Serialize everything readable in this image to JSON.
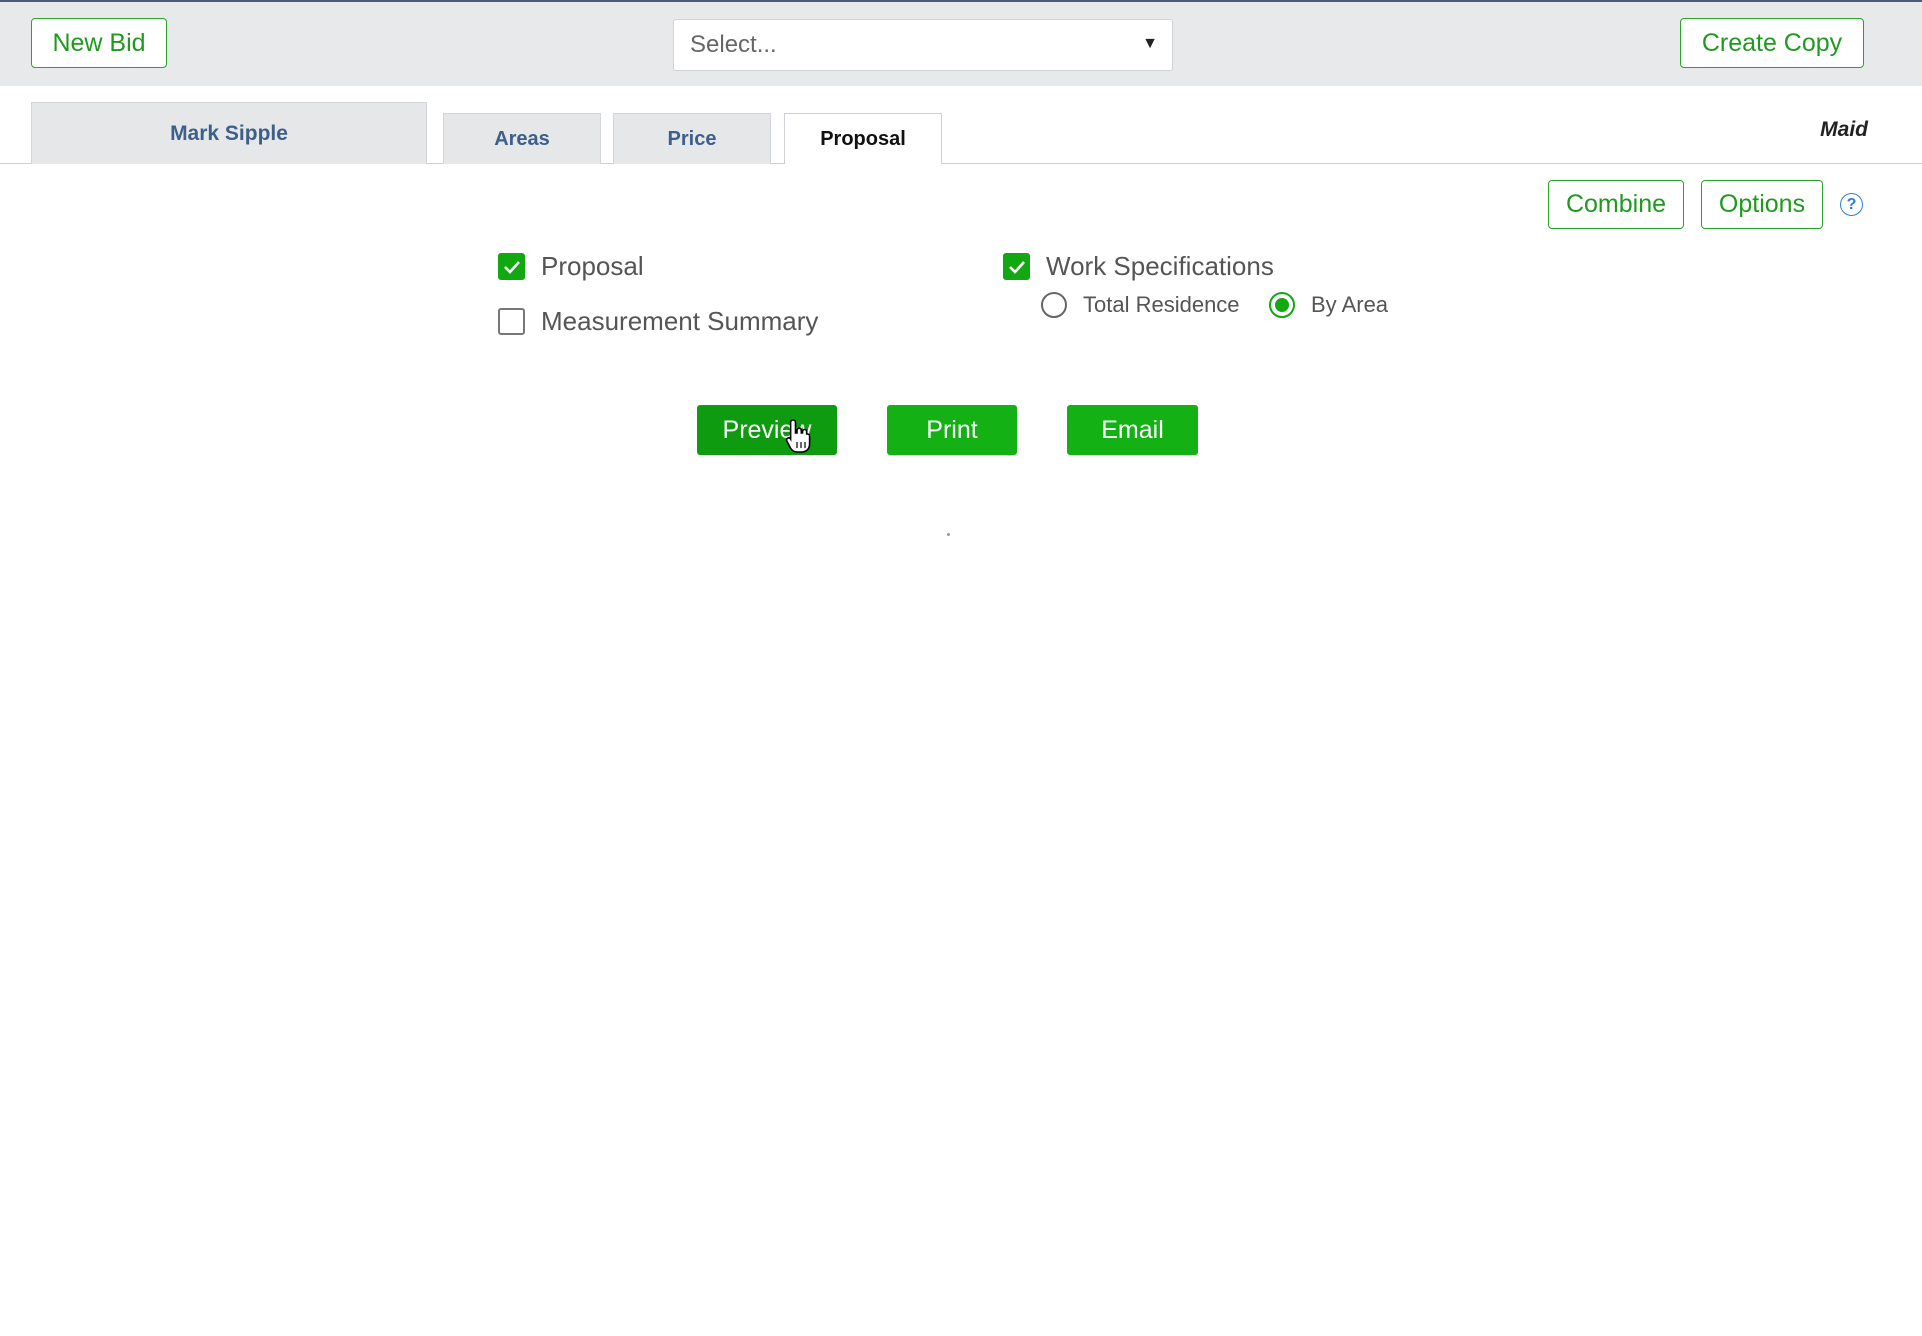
{
  "toolbar": {
    "new_bid_label": "New Bid",
    "select_placeholder": "Select...",
    "create_copy_label": "Create Copy"
  },
  "tabs": {
    "customer_name": "Mark Sipple",
    "items": [
      {
        "label": "Areas"
      },
      {
        "label": "Price"
      },
      {
        "label": "Proposal",
        "active": true
      }
    ],
    "role_label": "Maid"
  },
  "actions": {
    "combine_label": "Combine",
    "options_label": "Options",
    "help_icon_glyph": "?"
  },
  "options": {
    "proposal": {
      "label": "Proposal",
      "checked": true
    },
    "measurement_summary": {
      "label": "Measurement Summary",
      "checked": false
    },
    "work_specifications": {
      "label": "Work Specifications",
      "checked": true
    },
    "scope": {
      "options": [
        {
          "label": "Total Residence",
          "selected": false
        },
        {
          "label": "By Area",
          "selected": true
        }
      ]
    }
  },
  "buttons": {
    "preview_label": "Preview",
    "print_label": "Print",
    "email_label": "Email"
  },
  "colors": {
    "accent_green": "#13b113",
    "tab_text_blue": "#3d5f8a",
    "help_blue": "#2f7fd4"
  }
}
